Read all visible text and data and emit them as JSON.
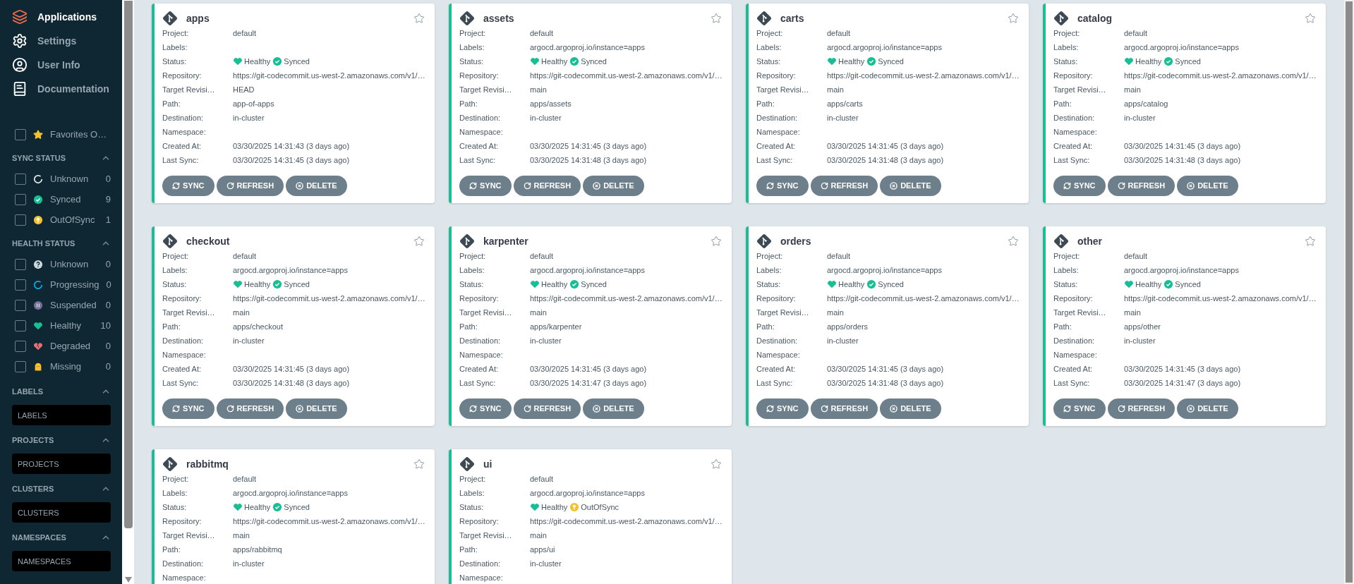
{
  "nav": [
    {
      "label": "Applications",
      "selected": true
    },
    {
      "label": "Settings",
      "selected": false
    },
    {
      "label": "User Info",
      "selected": false
    },
    {
      "label": "Documentation",
      "selected": false
    }
  ],
  "favorites": {
    "label": "Favorites O…",
    "checked": false
  },
  "status_filters": [
    {
      "title": "SYNC STATUS",
      "items": [
        {
          "label": "Unknown",
          "count": "0",
          "kind": "sync-unknown",
          "checked": false
        },
        {
          "label": "Synced",
          "count": "9",
          "kind": "synced",
          "checked": false
        },
        {
          "label": "OutOfSync",
          "count": "1",
          "kind": "out-of-sync",
          "checked": false
        }
      ]
    },
    {
      "title": "HEALTH STATUS",
      "items": [
        {
          "label": "Unknown",
          "count": "0",
          "kind": "health-unknown",
          "checked": false
        },
        {
          "label": "Progressing",
          "count": "0",
          "kind": "progressing",
          "checked": false
        },
        {
          "label": "Suspended",
          "count": "0",
          "kind": "suspended",
          "checked": false
        },
        {
          "label": "Healthy",
          "count": "10",
          "kind": "healthy",
          "checked": false
        },
        {
          "label": "Degraded",
          "count": "0",
          "kind": "degraded",
          "checked": false
        },
        {
          "label": "Missing",
          "count": "0",
          "kind": "missing",
          "checked": false
        }
      ]
    }
  ],
  "text_filters": [
    {
      "title": "LABELS",
      "placeholder": "LABELS"
    },
    {
      "title": "PROJECTS",
      "placeholder": "PROJECTS"
    },
    {
      "title": "CLUSTERS",
      "placeholder": "CLUSTERS"
    },
    {
      "title": "NAMESPACES",
      "placeholder": "NAMESPACES"
    }
  ],
  "apps": [
    {
      "name": "apps",
      "starred": false,
      "fields": [
        {
          "label": "Project:",
          "value": "default"
        },
        {
          "label": "Labels:"
        },
        {
          "label": "Status:",
          "health": {
            "kind": "healthy",
            "text": "Healthy"
          },
          "sync": {
            "kind": "synced",
            "text": "Synced"
          }
        },
        {
          "label": "Repository:",
          "value": "https://git-codecommit.us-west-2.amazonaws.com/v1/…"
        },
        {
          "label": "Target Revisi…",
          "value": "HEAD"
        },
        {
          "label": "Path:",
          "value": "app-of-apps"
        },
        {
          "label": "Destination:",
          "value": "in-cluster"
        },
        {
          "label": "Namespace:"
        },
        {
          "label": "Created At:",
          "value": "03/30/2025 14:31:43  (3 days ago)"
        },
        {
          "label": "Last Sync:",
          "value": "03/30/2025 14:31:45  (3 days ago)"
        }
      ],
      "buttons": [
        "SYNC",
        "REFRESH",
        "DELETE"
      ]
    },
    {
      "name": "assets",
      "starred": false,
      "fields": [
        {
          "label": "Project:",
          "value": "default"
        },
        {
          "label": "Labels:",
          "value": "argocd.argoproj.io/instance=apps"
        },
        {
          "label": "Status:",
          "health": {
            "kind": "healthy",
            "text": "Healthy"
          },
          "sync": {
            "kind": "synced",
            "text": "Synced"
          }
        },
        {
          "label": "Repository:",
          "value": "https://git-codecommit.us-west-2.amazonaws.com/v1/…"
        },
        {
          "label": "Target Revisi…",
          "value": "main"
        },
        {
          "label": "Path:",
          "value": "apps/assets"
        },
        {
          "label": "Destination:",
          "value": "in-cluster"
        },
        {
          "label": "Namespace:"
        },
        {
          "label": "Created At:",
          "value": "03/30/2025 14:31:45  (3 days ago)"
        },
        {
          "label": "Last Sync:",
          "value": "03/30/2025 14:31:48  (3 days ago)"
        }
      ],
      "buttons": [
        "SYNC",
        "REFRESH",
        "DELETE"
      ]
    },
    {
      "name": "carts",
      "starred": false,
      "fields": [
        {
          "label": "Project:",
          "value": "default"
        },
        {
          "label": "Labels:",
          "value": "argocd.argoproj.io/instance=apps"
        },
        {
          "label": "Status:",
          "health": {
            "kind": "healthy",
            "text": "Healthy"
          },
          "sync": {
            "kind": "synced",
            "text": "Synced"
          }
        },
        {
          "label": "Repository:",
          "value": "https://git-codecommit.us-west-2.amazonaws.com/v1/…"
        },
        {
          "label": "Target Revisi…",
          "value": "main"
        },
        {
          "label": "Path:",
          "value": "apps/carts"
        },
        {
          "label": "Destination:",
          "value": "in-cluster"
        },
        {
          "label": "Namespace:"
        },
        {
          "label": "Created At:",
          "value": "03/30/2025 14:31:45  (3 days ago)"
        },
        {
          "label": "Last Sync:",
          "value": "03/30/2025 14:31:48  (3 days ago)"
        }
      ],
      "buttons": [
        "SYNC",
        "REFRESH",
        "DELETE"
      ]
    },
    {
      "name": "catalog",
      "starred": false,
      "fields": [
        {
          "label": "Project:",
          "value": "default"
        },
        {
          "label": "Labels:",
          "value": "argocd.argoproj.io/instance=apps"
        },
        {
          "label": "Status:",
          "health": {
            "kind": "healthy",
            "text": "Healthy"
          },
          "sync": {
            "kind": "synced",
            "text": "Synced"
          }
        },
        {
          "label": "Repository:",
          "value": "https://git-codecommit.us-west-2.amazonaws.com/v1/…"
        },
        {
          "label": "Target Revisi…",
          "value": "main"
        },
        {
          "label": "Path:",
          "value": "apps/catalog"
        },
        {
          "label": "Destination:",
          "value": "in-cluster"
        },
        {
          "label": "Namespace:"
        },
        {
          "label": "Created At:",
          "value": "03/30/2025 14:31:45  (3 days ago)"
        },
        {
          "label": "Last Sync:",
          "value": "03/30/2025 14:31:48  (3 days ago)"
        }
      ],
      "buttons": [
        "SYNC",
        "REFRESH",
        "DELETE"
      ]
    },
    {
      "name": "checkout",
      "starred": false,
      "fields": [
        {
          "label": "Project:",
          "value": "default"
        },
        {
          "label": "Labels:",
          "value": "argocd.argoproj.io/instance=apps"
        },
        {
          "label": "Status:",
          "health": {
            "kind": "healthy",
            "text": "Healthy"
          },
          "sync": {
            "kind": "synced",
            "text": "Synced"
          }
        },
        {
          "label": "Repository:",
          "value": "https://git-codecommit.us-west-2.amazonaws.com/v1/…"
        },
        {
          "label": "Target Revisi…",
          "value": "main"
        },
        {
          "label": "Path:",
          "value": "apps/checkout"
        },
        {
          "label": "Destination:",
          "value": "in-cluster"
        },
        {
          "label": "Namespace:"
        },
        {
          "label": "Created At:",
          "value": "03/30/2025 14:31:45  (3 days ago)"
        },
        {
          "label": "Last Sync:",
          "value": "03/30/2025 14:31:48  (3 days ago)"
        }
      ],
      "buttons": [
        "SYNC",
        "REFRESH",
        "DELETE"
      ]
    },
    {
      "name": "karpenter",
      "starred": false,
      "fields": [
        {
          "label": "Project:",
          "value": "default"
        },
        {
          "label": "Labels:",
          "value": "argocd.argoproj.io/instance=apps"
        },
        {
          "label": "Status:",
          "health": {
            "kind": "healthy",
            "text": "Healthy"
          },
          "sync": {
            "kind": "synced",
            "text": "Synced"
          }
        },
        {
          "label": "Repository:",
          "value": "https://git-codecommit.us-west-2.amazonaws.com/v1/…"
        },
        {
          "label": "Target Revisi…",
          "value": "main"
        },
        {
          "label": "Path:",
          "value": "apps/karpenter"
        },
        {
          "label": "Destination:",
          "value": "in-cluster"
        },
        {
          "label": "Namespace:"
        },
        {
          "label": "Created At:",
          "value": "03/30/2025 14:31:45  (3 days ago)"
        },
        {
          "label": "Last Sync:",
          "value": "03/30/2025 14:31:47  (3 days ago)"
        }
      ],
      "buttons": [
        "SYNC",
        "REFRESH",
        "DELETE"
      ]
    },
    {
      "name": "orders",
      "starred": false,
      "fields": [
        {
          "label": "Project:",
          "value": "default"
        },
        {
          "label": "Labels:",
          "value": "argocd.argoproj.io/instance=apps"
        },
        {
          "label": "Status:",
          "health": {
            "kind": "healthy",
            "text": "Healthy"
          },
          "sync": {
            "kind": "synced",
            "text": "Synced"
          }
        },
        {
          "label": "Repository:",
          "value": "https://git-codecommit.us-west-2.amazonaws.com/v1/…"
        },
        {
          "label": "Target Revisi…",
          "value": "main"
        },
        {
          "label": "Path:",
          "value": "apps/orders"
        },
        {
          "label": "Destination:",
          "value": "in-cluster"
        },
        {
          "label": "Namespace:"
        },
        {
          "label": "Created At:",
          "value": "03/30/2025 14:31:45  (3 days ago)"
        },
        {
          "label": "Last Sync:",
          "value": "03/30/2025 14:31:48  (3 days ago)"
        }
      ],
      "buttons": [
        "SYNC",
        "REFRESH",
        "DELETE"
      ]
    },
    {
      "name": "other",
      "starred": false,
      "fields": [
        {
          "label": "Project:",
          "value": "default"
        },
        {
          "label": "Labels:",
          "value": "argocd.argoproj.io/instance=apps"
        },
        {
          "label": "Status:",
          "health": {
            "kind": "healthy",
            "text": "Healthy"
          },
          "sync": {
            "kind": "synced",
            "text": "Synced"
          }
        },
        {
          "label": "Repository:",
          "value": "https://git-codecommit.us-west-2.amazonaws.com/v1/…"
        },
        {
          "label": "Target Revisi…",
          "value": "main"
        },
        {
          "label": "Path:",
          "value": "apps/other"
        },
        {
          "label": "Destination:",
          "value": "in-cluster"
        },
        {
          "label": "Namespace:"
        },
        {
          "label": "Created At:",
          "value": "03/30/2025 14:31:45  (3 days ago)"
        },
        {
          "label": "Last Sync:",
          "value": "03/30/2025 14:31:47  (3 days ago)"
        }
      ],
      "buttons": [
        "SYNC",
        "REFRESH",
        "DELETE"
      ]
    },
    {
      "name": "rabbitmq",
      "starred": false,
      "fields": [
        {
          "label": "Project:",
          "value": "default"
        },
        {
          "label": "Labels:",
          "value": "argocd.argoproj.io/instance=apps"
        },
        {
          "label": "Status:",
          "health": {
            "kind": "healthy",
            "text": "Healthy"
          },
          "sync": {
            "kind": "synced",
            "text": "Synced"
          }
        },
        {
          "label": "Repository:",
          "value": "https://git-codecommit.us-west-2.amazonaws.com/v1/…"
        },
        {
          "label": "Target Revisi…",
          "value": "main"
        },
        {
          "label": "Path:",
          "value": "apps/rabbitmq"
        },
        {
          "label": "Destination:",
          "value": "in-cluster"
        },
        {
          "label": "Namespace:"
        }
      ]
    },
    {
      "name": "ui",
      "starred": false,
      "fields": [
        {
          "label": "Project:",
          "value": "default"
        },
        {
          "label": "Labels:",
          "value": "argocd.argoproj.io/instance=apps"
        },
        {
          "label": "Status:",
          "health": {
            "kind": "healthy",
            "text": "Healthy"
          },
          "sync": {
            "kind": "out-of-sync",
            "text": "OutOfSync"
          }
        },
        {
          "label": "Repository:",
          "value": "https://git-codecommit.us-west-2.amazonaws.com/v1/…"
        },
        {
          "label": "Target Revisi…",
          "value": "main"
        },
        {
          "label": "Path:",
          "value": "apps/ui"
        },
        {
          "label": "Destination:",
          "value": "in-cluster"
        },
        {
          "label": "Namespace:"
        }
      ]
    }
  ]
}
